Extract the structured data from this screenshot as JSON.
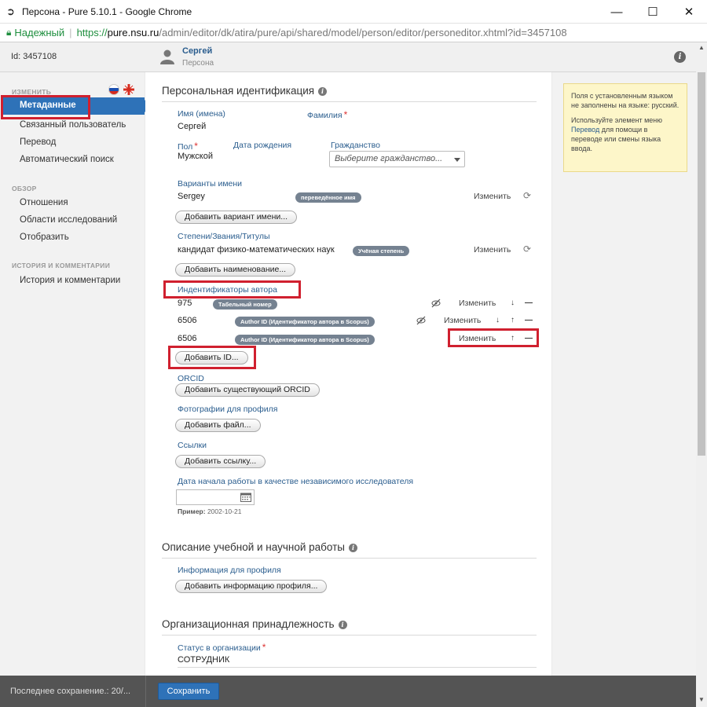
{
  "window": {
    "title": "Персона - Pure 5.10.1 - Google Chrome",
    "controls": {
      "minimize": "—",
      "maximize": "☐",
      "close": "✕"
    }
  },
  "address": {
    "secure_label": "Надежный",
    "proto": "https://",
    "host": "pure.nsu.ru",
    "path": "/admin/editor/dk/atira/pure/api/shared/model/person/editor/personeditor.xhtml?id=3457108"
  },
  "header": {
    "id_text": "Id: 3457108",
    "person_name": "Сергей",
    "person_type": "Персона",
    "info_glyph": "i"
  },
  "sidebar": {
    "edit_heading": "ИЗМЕНИТЬ",
    "edit_items": [
      "Метаданные",
      "Связанный пользователь",
      "Перевод",
      "Автоматический поиск"
    ],
    "review_heading": "ОБЗОР",
    "review_items": [
      "Отношения",
      "Области исследований",
      "Отобразить"
    ],
    "history_heading": "ИСТОРИЯ И КОММЕНТАРИИ",
    "history_items": [
      "История и комментарии"
    ]
  },
  "main": {
    "info_glyph": "i",
    "section1": {
      "title": "Персональная идентификация",
      "first_name_label": "Имя (имена)",
      "first_name_value": "Сергей",
      "last_name_label": "Фамилия",
      "required_mark": "*",
      "gender_label": "Пол",
      "gender_value": "Мужской",
      "birthdate_label": "Дата рождения",
      "citizenship_label": "Гражданство",
      "citizenship_placeholder": "Выберите гражданство...",
      "name_variants_label": "Варианты имени",
      "name_variant_value": "Sergey",
      "name_variant_tag": "переведённое имя",
      "change_label": "Изменить",
      "add_name_variant": "Добавить вариант имени...",
      "degrees_label": "Степени/Звания/Титулы",
      "degree_value": "кандидат физико-математических наук",
      "degree_tag": "Учёная степень",
      "add_title": "Добавить наименование...",
      "author_ids_label": "Индентификаторы автора",
      "ids": [
        {
          "value": "975",
          "tag": "Табельный номер"
        },
        {
          "value": "6506",
          "tag": "Author ID (Идентификатор автора в Scopus)"
        },
        {
          "value": "6506",
          "tag": "Author ID (Идентификатор автора в Scopus)"
        }
      ],
      "arrow_down": "↓",
      "arrow_up": "↑",
      "remove": "—",
      "add_id": "Добавить ID...",
      "orcid_label": "ORCID",
      "add_orcid": "Добавить существующий ORCID",
      "photos_label": "Фотографии для профиля",
      "add_file": "Добавить файл...",
      "links_label": "Ссылки",
      "add_link": "Добавить ссылку...",
      "start_date_label": "Дата начала работы в качестве независимого исследователя",
      "example_label": "Пример:",
      "example_value": "2002-10-21"
    },
    "section2": {
      "title": "Описание учебной и научной работы",
      "profile_info_label": "Информация для профиля",
      "add_profile_info": "Добавить информацию профиля..."
    },
    "section3": {
      "title": "Организационная принадлежность",
      "status_label": "Статус в организации",
      "status_value": "СОТРУДНИК"
    }
  },
  "tip": {
    "line1": "Поля с установленным языком не заполнены на языке: русский.",
    "line2_pre": "Используйте элемент меню",
    "line2_link": "Перевод",
    "line2_post": "для помощи в переводе или смены языка ввода."
  },
  "footer": {
    "last_save": "Последнее сохранение.: 20/...",
    "save_button": "Сохранить"
  },
  "colors": {
    "accent": "#2e72b8",
    "label": "#2a5d8e",
    "highlight": "#d0202f",
    "tag": "#758291"
  }
}
